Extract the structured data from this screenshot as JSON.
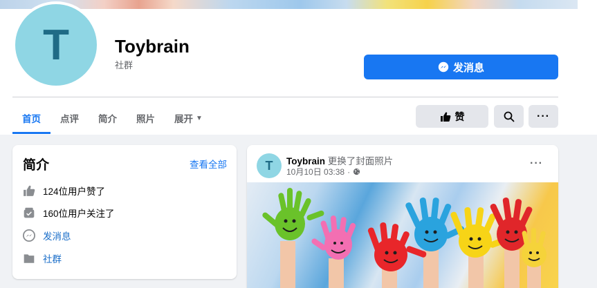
{
  "page": {
    "name": "Toybrain",
    "category": "社群",
    "avatar_letter": "T"
  },
  "header": {
    "message_button": "发消息"
  },
  "tabs": [
    {
      "label": "首页",
      "active": true
    },
    {
      "label": "点评",
      "active": false
    },
    {
      "label": "简介",
      "active": false
    },
    {
      "label": "照片",
      "active": false
    },
    {
      "label": "展开",
      "active": false
    }
  ],
  "actions": {
    "like_label": "赞"
  },
  "intro": {
    "title": "简介",
    "see_all": "查看全部",
    "items": [
      {
        "icon": "thumbs-up-icon",
        "text": "124位用户赞了"
      },
      {
        "icon": "follow-icon",
        "text": "160位用户关注了"
      },
      {
        "icon": "messenger-icon",
        "text": "发消息"
      },
      {
        "icon": "category-icon",
        "text": "社群"
      }
    ]
  },
  "post": {
    "author": "Toybrain",
    "action": "更换了封面照片",
    "time": "10月10日 03:38",
    "privacy_icon": "globe-icon"
  },
  "colors": {
    "accent": "#1877f2",
    "avatar_bg": "#8fd6e4",
    "avatar_letter": "#1f6b86",
    "body_bg": "#f0f2f5"
  }
}
